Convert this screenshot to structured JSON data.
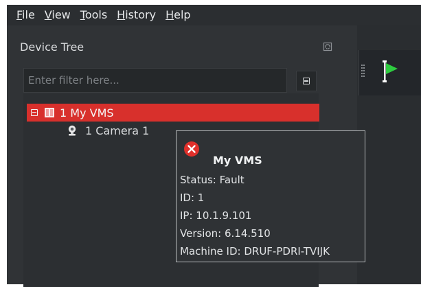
{
  "menubar": {
    "items": [
      {
        "label": "File",
        "accel": "F",
        "rest": "ile"
      },
      {
        "label": "View",
        "accel": "V",
        "rest": "iew"
      },
      {
        "label": "Tools",
        "accel": "T",
        "rest": "ools"
      },
      {
        "label": "History",
        "accel": "H",
        "rest": "istory"
      },
      {
        "label": "Help",
        "accel": "H",
        "rest": "elp"
      }
    ]
  },
  "device_tree": {
    "title": "Device Tree",
    "filter_placeholder": "Enter filter here...",
    "nodes": [
      {
        "label": "1 My VMS",
        "selected": true,
        "icon": "server-icon"
      },
      {
        "label": "1 Camera 1",
        "icon": "camera-icon"
      }
    ]
  },
  "tooltip": {
    "icon": "error-icon",
    "title": "My VMS",
    "lines": [
      "Status: Fault",
      "ID: 1",
      "IP: 10.1.9.101",
      "Version: 6.14.510",
      "Machine ID: DRUF-PDRI-TVIJK"
    ]
  },
  "colors": {
    "selection": "#d8302c",
    "accent_green": "#2ecc40",
    "error_red": "#e0302b"
  }
}
